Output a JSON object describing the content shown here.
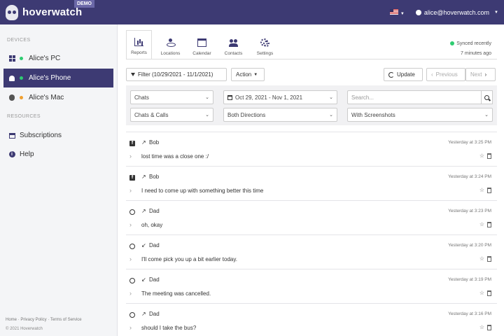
{
  "app": {
    "brand": "hoverwatch",
    "badge": "DEMO",
    "user_email": "alice@hoverwatch.com"
  },
  "sidebar": {
    "devices_title": "DEVICES",
    "devices": [
      {
        "label": "Alice's PC",
        "icon": "windows-icon",
        "status_color": "#2ecc71"
      },
      {
        "label": "Alice's Phone",
        "icon": "android-icon",
        "status_color": "#2ecc71"
      },
      {
        "label": "Alice's Mac",
        "icon": "apple-icon",
        "status_color": "#f0a030"
      }
    ],
    "resources_title": "RESOURCES",
    "resources": [
      {
        "label": "Subscriptions",
        "icon": "calendar-icon"
      },
      {
        "label": "Help",
        "icon": "info-icon"
      }
    ],
    "footer_links": "Home · Privacy Policy · Terms of Service",
    "footer_copy": "© 2021 Hoverwatch"
  },
  "tabs": [
    {
      "label": "Reports",
      "icon": "bar-chart-icon"
    },
    {
      "label": "Locations",
      "icon": "location-icon"
    },
    {
      "label": "Calendar",
      "icon": "calendar-icon"
    },
    {
      "label": "Contacts",
      "icon": "contacts-icon"
    },
    {
      "label": "Settings",
      "icon": "gears-icon"
    }
  ],
  "sync": {
    "status": "Synced recently",
    "ago": "7 minutes ago"
  },
  "toolbar": {
    "filter": "Filter (10/29/2021 - 11/1/2021)",
    "action": "Action",
    "update": "Update",
    "previous": "Previous",
    "next": "Next"
  },
  "filters": {
    "type": "Chats",
    "date_range": "Oct 29, 2021 - Nov 1, 2021",
    "search_placeholder": "Search...",
    "subtype": "Chats & Calls",
    "direction": "Both Directions",
    "screenshots": "With Screenshots"
  },
  "messages": [
    {
      "app_icon": "facebook-icon",
      "direction_arrow": "↗",
      "contact": "Bob",
      "time": "Yesterday at 3:25 PM",
      "text": "lost time was a close one :/"
    },
    {
      "app_icon": "facebook-icon",
      "direction_arrow": "↗",
      "contact": "Bob",
      "time": "Yesterday at 3:24 PM",
      "text": "I need to come up with something better this time"
    },
    {
      "app_icon": "whatsapp-icon",
      "direction_arrow": "↗",
      "contact": "Dad",
      "time": "Yesterday at 3:23 PM",
      "text": "oh, okay"
    },
    {
      "app_icon": "whatsapp-icon",
      "direction_arrow": "↙",
      "contact": "Dad",
      "time": "Yesterday at 3:20 PM",
      "text": "I'll come pick you up a bit earlier today."
    },
    {
      "app_icon": "whatsapp-icon",
      "direction_arrow": "↙",
      "contact": "Dad",
      "time": "Yesterday at 3:19 PM",
      "text": "The meeting was cancelled."
    },
    {
      "app_icon": "whatsapp-icon",
      "direction_arrow": "↗",
      "contact": "Dad",
      "time": "Yesterday at 3:16 PM",
      "text": "should I take the bus?"
    }
  ]
}
